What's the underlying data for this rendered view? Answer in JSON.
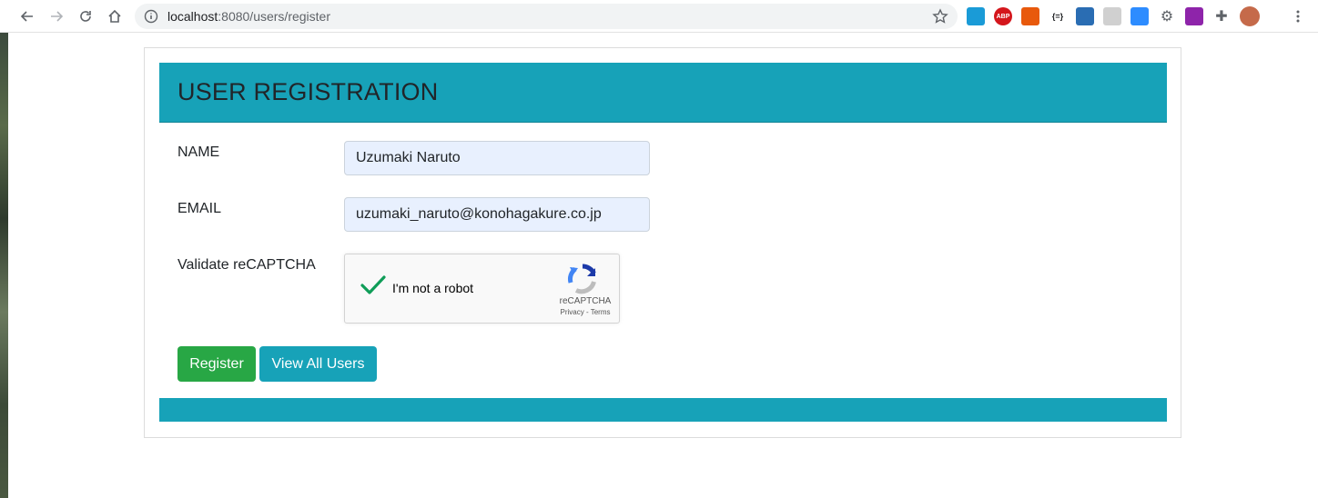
{
  "browser": {
    "url_host": "localhost",
    "url_path": ":8080/users/register",
    "extensions": [
      {
        "name": "window-ext-icon",
        "color": "#1a9bd7",
        "text": ""
      },
      {
        "name": "abp-icon",
        "color": "#d4161c",
        "text": "ABP"
      },
      {
        "name": "tree-ext-icon",
        "color": "#e8590c",
        "text": ""
      },
      {
        "name": "json-ext-icon",
        "color": "#ffffff",
        "text": "{=}"
      },
      {
        "name": "s-ext-icon",
        "color": "#2a6db3",
        "text": ""
      },
      {
        "name": "grey-ext-icon",
        "color": "#d0d0d0",
        "text": ""
      },
      {
        "name": "zoom-icon",
        "color": "#2d8cff",
        "text": ""
      },
      {
        "name": "gear-ext-icon",
        "color": "#5f6368",
        "text": ""
      },
      {
        "name": "color-ext-icon",
        "color": "#8e24aa",
        "text": ""
      },
      {
        "name": "puzzle-icon",
        "color": "#5f6368",
        "text": ""
      },
      {
        "name": "avatar",
        "color": "#c56a4a",
        "text": ""
      }
    ]
  },
  "page": {
    "header_title": "USER REGISTRATION",
    "form": {
      "name_label": "NAME",
      "name_value": "Uzumaki Naruto",
      "email_label": "EMAIL",
      "email_value": "uzumaki_naruto@konohagakure.co.jp",
      "captcha_label": "Validate reCAPTCHA"
    },
    "recaptcha": {
      "checkbox_text": "I'm not a robot",
      "brand": "reCAPTCHA",
      "links": "Privacy - Terms",
      "checked": true
    },
    "buttons": {
      "register": "Register",
      "view_all": "View All Users"
    }
  },
  "colors": {
    "header": "#17a2b8",
    "register_btn": "#28a745",
    "view_btn": "#17a2b8",
    "input_bg": "#e8f0fe"
  }
}
